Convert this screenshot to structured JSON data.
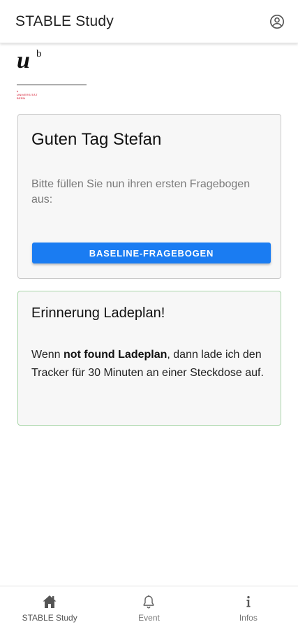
{
  "appbar": {
    "title": "STABLE Study",
    "account_icon": "account-circle-icon"
  },
  "logo": {
    "letter": "u",
    "superscript": "b",
    "line1": "b",
    "line2": "UNIVERSITÄT",
    "line3": "BERN"
  },
  "greeting_card": {
    "title": "Guten Tag Stefan",
    "text": "Bitte füllen Sie nun ihren ersten Fragebogen aus:",
    "button_label": "BASELINE-FRAGEBOGEN",
    "button_color": "#1a7cf2"
  },
  "reminder_card": {
    "title": "Erinnerung Ladeplan!",
    "text_before": "Wenn ",
    "text_bold": "not found Ladeplan",
    "text_after": ", dann lade ich den Tracker für 30 Minuten an einer Steckdose auf.",
    "border_color": "#a9d6a9"
  },
  "bottom_nav": {
    "items": [
      {
        "label": "STABLE Study",
        "icon": "home-icon",
        "active": true
      },
      {
        "label": "Event",
        "icon": "bell-icon",
        "active": false
      },
      {
        "label": "Infos",
        "icon": "info-icon",
        "active": false
      }
    ]
  }
}
